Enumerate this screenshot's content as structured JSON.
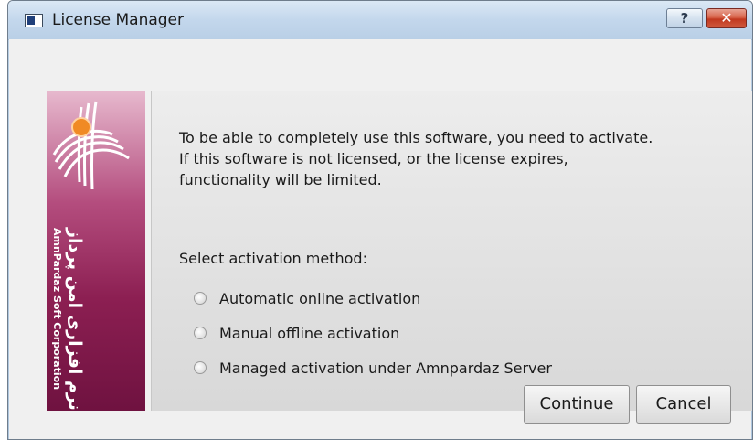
{
  "window": {
    "title": "License Manager",
    "help_glyph": "?",
    "close_glyph": "✕"
  },
  "banner": {
    "company_en": "AmnPardaz Soft Corporation",
    "company_fa": "شرکت نرم افزاری امن پرداز",
    "colors": [
      "#e7b9ce",
      "#8c1f52"
    ]
  },
  "message": {
    "lines": [
      "To be able to completely use this software, you need to activate.",
      "If this software is not licensed, or the license expires,",
      "functionality will be limited."
    ]
  },
  "activation": {
    "label": "Select activation method:",
    "options": [
      "Automatic online activation",
      "Manual offline activation",
      "Managed activation under Amnpardaz Server"
    ]
  },
  "buttons": {
    "continue": "Continue",
    "cancel": "Cancel"
  }
}
